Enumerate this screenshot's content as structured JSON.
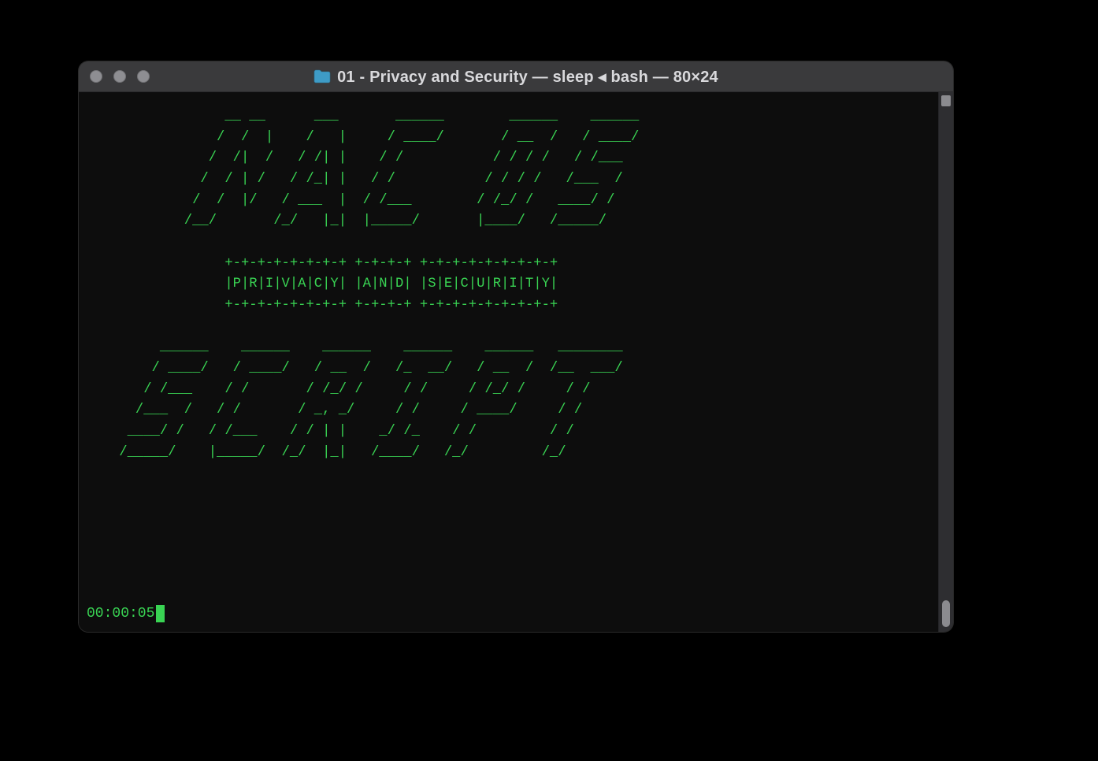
{
  "window": {
    "title": "01 - Privacy and Security — sleep ◂ bash — 80×24",
    "traffic_light_color": "#8e8e92",
    "folder_icon_color": "#3e9bc6"
  },
  "terminal": {
    "text_color": "#39d353",
    "background_color": "#0d0d0d",
    "timer": "00:00:05",
    "ascii_art_lines": [
      "                 __ __      ___       ______        ______    ______",
      "                /  /  |    /   |     / ____/       / __  /   / ____/",
      "               /  /|  /   / /| |    / /           / / / /   / /___  ",
      "              /  / | /   / /_| |   / /           / / / /   /___  /  ",
      "             /  /  |/   / ___  |  / /___        / /_/ /   ____/ /   ",
      "            /__/       /_/   |_|  |_____/       |____/   /_____/    ",
      "",
      "                 +-+-+-+-+-+-+-+ +-+-+-+ +-+-+-+-+-+-+-+-+",
      "                 |P|R|I|V|A|C|Y| |A|N|D| |S|E|C|U|R|I|T|Y|",
      "                 +-+-+-+-+-+-+-+ +-+-+-+ +-+-+-+-+-+-+-+-+",
      "",
      "         ______    ______    ______    ______    ______   ________",
      "        / ____/   / ____/   / __  /   /_  __/   / __  /  /__  ___/",
      "       / /___    / /       / /_/ /     / /     / /_/ /     / /    ",
      "      /___  /   / /       / _, _/     / /     / ____/     / /     ",
      "     ____/ /   / /___    / / | |    _/ /_    / /         / /      ",
      "    /_____/    |_____/  /_/  |_|   /____/   /_/         /_/       "
    ]
  }
}
